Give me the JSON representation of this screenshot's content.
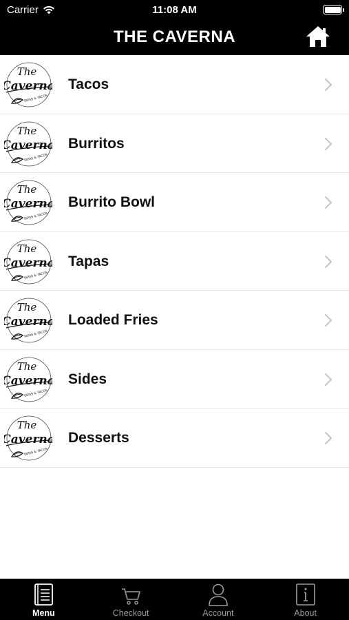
{
  "status": {
    "carrier": "Carrier",
    "time": "11:08 AM"
  },
  "header": {
    "title": "THE CAVERNA"
  },
  "logo": {
    "line1": "The",
    "line2": "Caverna",
    "tagline": "TAPAS & TACOS"
  },
  "menu": {
    "items": [
      {
        "label": "Tacos"
      },
      {
        "label": "Burritos"
      },
      {
        "label": "Burrito Bowl"
      },
      {
        "label": "Tapas"
      },
      {
        "label": "Loaded Fries"
      },
      {
        "label": "Sides"
      },
      {
        "label": "Desserts"
      }
    ]
  },
  "tabs": [
    {
      "label": "Menu",
      "icon": "book-icon",
      "active": true
    },
    {
      "label": "Checkout",
      "icon": "cart-icon",
      "active": false
    },
    {
      "label": "Account",
      "icon": "person-icon",
      "active": false
    },
    {
      "label": "About",
      "icon": "info-icon",
      "active": false
    }
  ],
  "colors": {
    "bar": "#000000",
    "tab_inactive": "#9a9a9a",
    "tab_active": "#ffffff"
  }
}
